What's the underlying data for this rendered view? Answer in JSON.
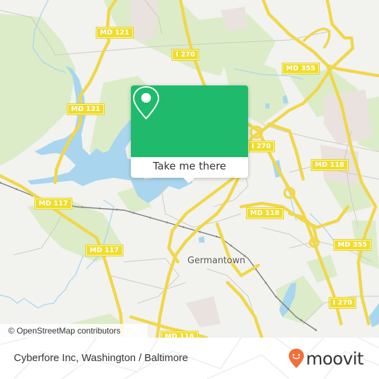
{
  "map": {
    "place_labels": [
      {
        "id": "germantown",
        "text": "Germantown"
      }
    ],
    "road_shields": [
      {
        "id": "md121-top",
        "text": "MD 121"
      },
      {
        "id": "md121-left",
        "text": "MD 121"
      },
      {
        "id": "i270-top",
        "text": "I 270"
      },
      {
        "id": "md355-top",
        "text": "MD 355"
      },
      {
        "id": "i270-mid",
        "text": "I 270"
      },
      {
        "id": "md118-right",
        "text": "MD 118"
      },
      {
        "id": "md117-left",
        "text": "MD 117"
      },
      {
        "id": "md117-lower",
        "text": "MD 117"
      },
      {
        "id": "md118-center",
        "text": "MD 118"
      },
      {
        "id": "md355-right",
        "text": "MD 355"
      },
      {
        "id": "i270-bottom",
        "text": "I 270"
      },
      {
        "id": "md118-bottom",
        "text": "MD 118"
      }
    ],
    "attribution": "© OpenStreetMap contributors",
    "colors": {
      "land": "#f2f2ef",
      "park": "#dbeccb",
      "water": "#a8d6ee",
      "road": "#f5e15a",
      "urban": "#e8e0dc"
    }
  },
  "popup": {
    "button_label": "Take me there",
    "icon": "map-pin-icon",
    "accent_color": "#1fba6b"
  },
  "footer": {
    "title": "Cyberfore Inc, Washington / Baltimore",
    "brand": "moovit",
    "brand_color": "#f26f3a"
  }
}
